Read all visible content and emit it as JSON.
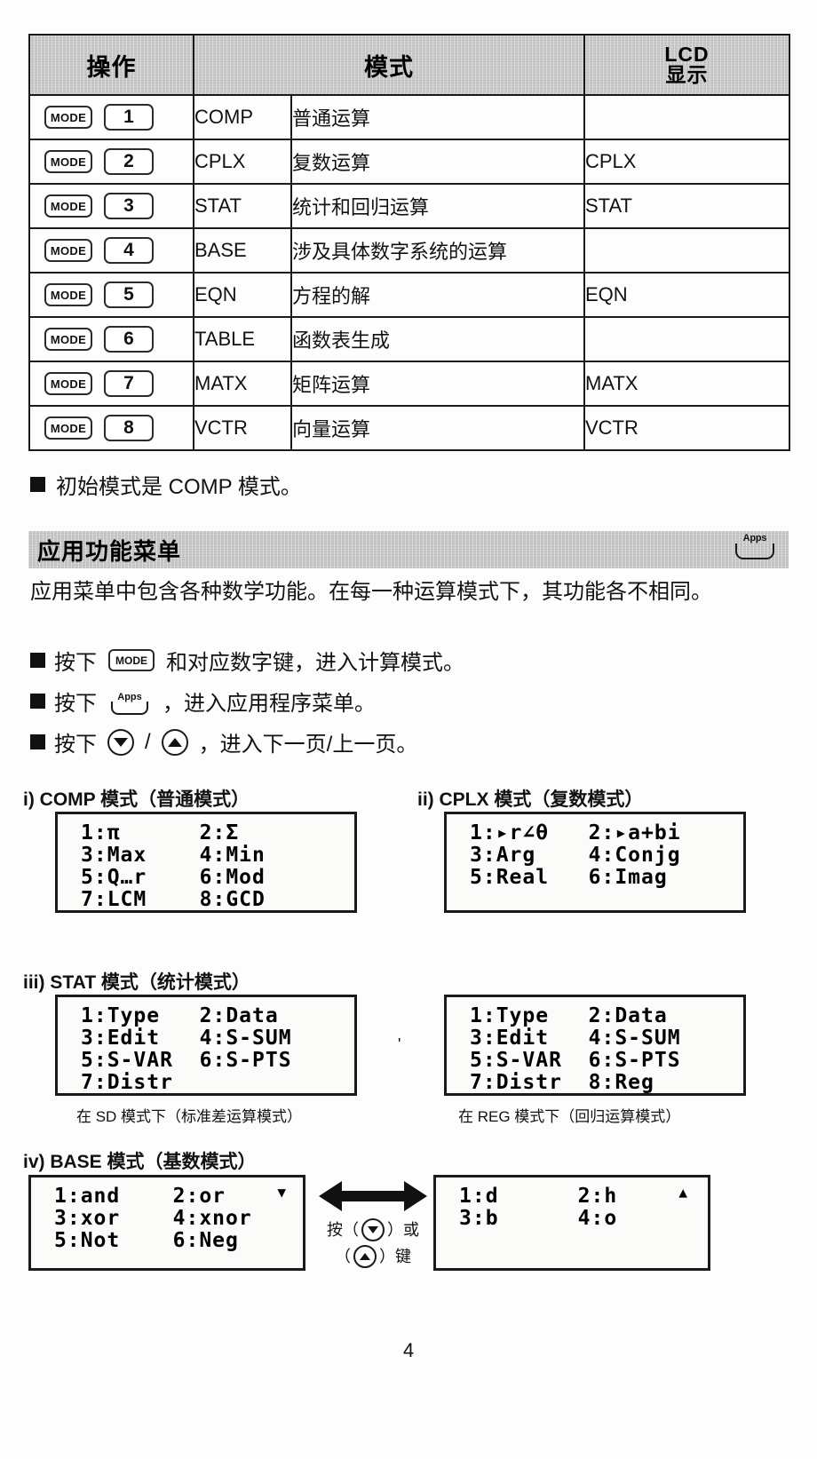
{
  "mode_table": {
    "headers": [
      "操作",
      "模式",
      "",
      "LCD\n显示"
    ],
    "header_op": "操作",
    "header_mode": "模式",
    "header_lcd_line1": "LCD",
    "header_lcd_line2": "显示",
    "mode_key_label": "MODE",
    "rows": [
      {
        "key": "MODE",
        "num": "1",
        "abbr": "COMP",
        "desc": "普通运算",
        "lcd": ""
      },
      {
        "key": "MODE",
        "num": "2",
        "abbr": "CPLX",
        "desc": "复数运算",
        "lcd": "CPLX"
      },
      {
        "key": "MODE",
        "num": "3",
        "abbr": "STAT",
        "desc": "统计和回归运算",
        "lcd": "STAT"
      },
      {
        "key": "MODE",
        "num": "4",
        "abbr": "BASE",
        "desc": "涉及具体数字系统的运算",
        "lcd": ""
      },
      {
        "key": "MODE",
        "num": "5",
        "abbr": "EQN",
        "desc": "方程的解",
        "lcd": "EQN"
      },
      {
        "key": "MODE",
        "num": "6",
        "abbr": "TABLE",
        "desc": "函数表生成",
        "lcd": ""
      },
      {
        "key": "MODE",
        "num": "7",
        "abbr": "MATX",
        "desc": "矩阵运算",
        "lcd": "MATX"
      },
      {
        "key": "MODE",
        "num": "8",
        "abbr": "VCTR",
        "desc": "向量运算",
        "lcd": "VCTR"
      }
    ]
  },
  "note": {
    "text": "初始模式是 COMP 模式。"
  },
  "section": {
    "title": "应用功能菜单",
    "apps_key_label": "Apps"
  },
  "intro": {
    "paragraph": "应用菜单中包含各种数学功能。在每一种运算模式下，其功能各不相同。"
  },
  "bullets": {
    "b1_pre": "按下",
    "b1_key": "MODE",
    "b1_post": "和对应数字键，进入计算模式。",
    "b2_pre": "按下",
    "b2_key": "Apps",
    "b2_post": "，进入应用程序菜单。",
    "b3_pre": "按下",
    "b3_sep": "/",
    "b3_post": "，进入下一页/上一页。"
  },
  "examples": {
    "comp": {
      "label": "i) COMP 模式（普通模式）",
      "screen": [
        "1:π      2:Σ",
        "3:Max    4:Min",
        "5:Q…r    6:Mod",
        "7:LCM    8:GCD"
      ]
    },
    "cplx": {
      "label": "ii) CPLX 模式（复数模式）",
      "screen": [
        "1:▸r∠θ   2:▸a+bi",
        "3:Arg    4:Conjg",
        "5:Real   6:Imag"
      ]
    },
    "stat": {
      "label": "iii) STAT 模式（统计模式）",
      "sd": {
        "screen": [
          "1:Type   2:Data",
          "3:Edit   4:S-SUM",
          "5:S-VAR  6:S-PTS",
          "7:Distr"
        ],
        "caption": "在 SD 模式下（标准差运算模式）"
      },
      "reg": {
        "screen": [
          "1:Type   2:Data",
          "3:Edit   4:S-SUM",
          "5:S-VAR  6:S-PTS",
          "7:Distr  8:Reg"
        ],
        "caption": "在 REG 模式下（回归运算模式）"
      }
    },
    "base": {
      "label": "iv) BASE 模式（基数模式）",
      "page1": {
        "screen": [
          "1:and    2:or",
          "3:xor    4:xnor",
          "5:Not    6:Neg"
        ],
        "marker": "▼"
      },
      "page2": {
        "screen": [
          "1:d      2:h",
          "3:b      4:o"
        ],
        "marker": "▲"
      },
      "swap_line1": "按（",
      "swap_line1_end": "）或",
      "swap_line2_start": "（",
      "swap_line2_end": "）键"
    }
  },
  "page_number": "4",
  "colors": {
    "header_gray": "#c9c9c9",
    "border": "#1a1a1a",
    "text": "#111111",
    "lcd_bg": "#fbfbfa"
  }
}
